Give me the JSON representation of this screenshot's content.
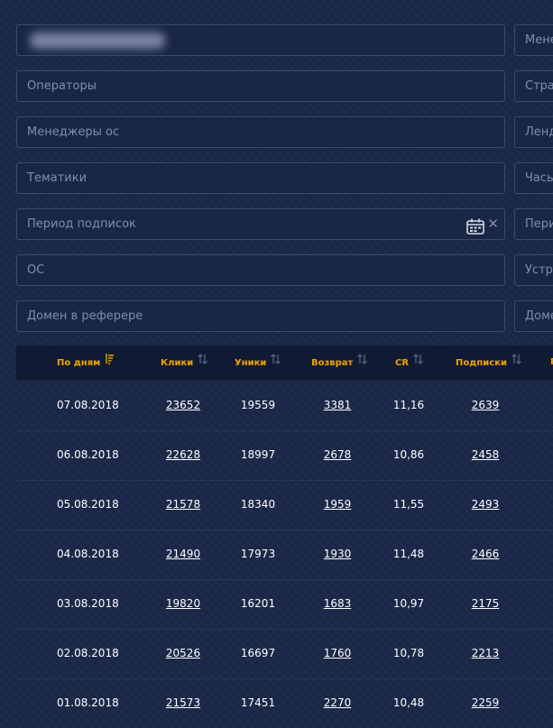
{
  "filters": {
    "left": [
      {
        "id": "blurred",
        "placeholder": ""
      },
      {
        "id": "operators",
        "placeholder": "Операторы"
      },
      {
        "id": "managers",
        "placeholder": "Менеджеры ос"
      },
      {
        "id": "topics",
        "placeholder": "Тематики"
      },
      {
        "id": "period",
        "placeholder": "Период подписок"
      },
      {
        "id": "os",
        "placeholder": "ОС"
      },
      {
        "id": "referer-domain",
        "placeholder": "Домен в реферере"
      }
    ],
    "right": [
      "Менеджеры",
      "Страны",
      "Лендинги",
      "Часы",
      "Период",
      "Устройства",
      "Домены"
    ]
  },
  "table": {
    "headers": {
      "date": "По дням",
      "clicks": "Клики",
      "uniques": "Уники",
      "returns": "Возврат",
      "cr": "CR",
      "subscriptions": "Подписки",
      "more": "Р"
    },
    "rows": [
      {
        "date": "07.08.2018",
        "clicks": "23652",
        "uniques": "19559",
        "returns": "3381",
        "cr": "11,16",
        "subscriptions": "2639"
      },
      {
        "date": "06.08.2018",
        "clicks": "22628",
        "uniques": "18997",
        "returns": "2678",
        "cr": "10,86",
        "subscriptions": "2458"
      },
      {
        "date": "05.08.2018",
        "clicks": "21578",
        "uniques": "18340",
        "returns": "1959",
        "cr": "11,55",
        "subscriptions": "2493"
      },
      {
        "date": "04.08.2018",
        "clicks": "21490",
        "uniques": "17973",
        "returns": "1930",
        "cr": "11,48",
        "subscriptions": "2466"
      },
      {
        "date": "03.08.2018",
        "clicks": "19820",
        "uniques": "16201",
        "returns": "1683",
        "cr": "10,97",
        "subscriptions": "2175"
      },
      {
        "date": "02.08.2018",
        "clicks": "20526",
        "uniques": "16697",
        "returns": "1760",
        "cr": "10,78",
        "subscriptions": "2213"
      },
      {
        "date": "01.08.2018",
        "clicks": "21573",
        "uniques": "17451",
        "returns": "2270",
        "cr": "10,48",
        "subscriptions": "2259"
      }
    ]
  },
  "colors": {
    "background": "#1b2848",
    "header_background": "#101b33",
    "header_text": "#f0a500",
    "field_border": "#3b4a6f",
    "placeholder": "#7f8eae",
    "cell_text": "#ffffff"
  }
}
